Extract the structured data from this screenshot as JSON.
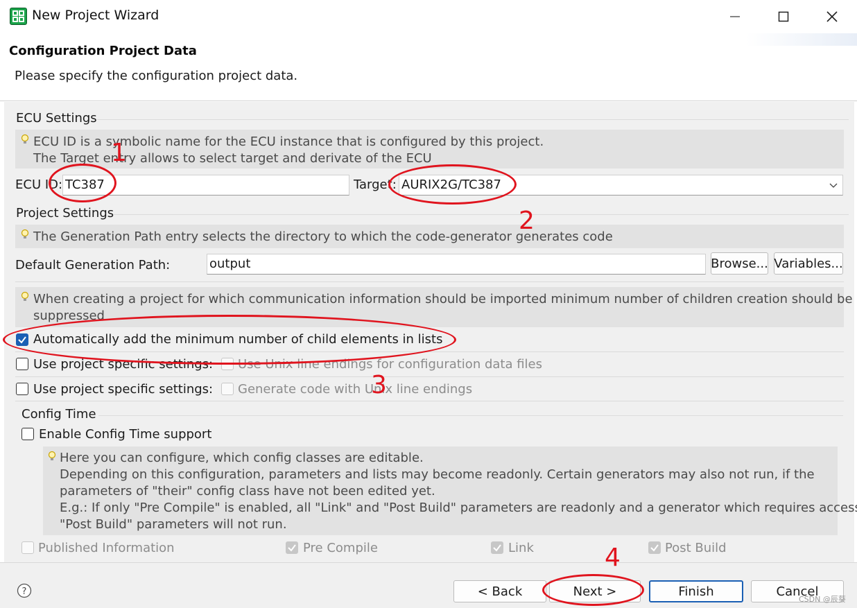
{
  "window": {
    "title": "New Project Wizard",
    "controls": [
      "minimize-icon",
      "maximize-icon",
      "close-icon"
    ]
  },
  "header": {
    "title": "Configuration Project Data",
    "description": "Please specify the configuration project data."
  },
  "ecu_settings": {
    "group_label": "ECU Settings",
    "hint_line1": "ECU ID is a symbolic name for the ECU instance that is configured by this project.",
    "hint_line2": "The Target entry allows to select target and derivate of the ECU",
    "ecu_id_label": "ECU ID:",
    "ecu_id_value": "TC387",
    "target_label": "Target:",
    "target_value": "AURIX2G/TC387"
  },
  "project_settings": {
    "group_label": "Project Settings",
    "hint": "The Generation Path entry selects the directory to which the code-generator generates code",
    "gen_path_label": "Default Generation Path:",
    "gen_path_value": "output",
    "browse_label": "Browse...",
    "variables_label": "Variables...",
    "hint2_line1": "When creating a project for which communication information should be imported minimum number of children creation should be",
    "hint2_line2": "suppressed",
    "auto_add_label": "Automatically add the minimum number of child elements in lists",
    "auto_add_checked": true,
    "specific1_label": "Use project specific settings:",
    "unix_cfg_label": "Use Unix line endings for configuration data files",
    "specific2_label": "Use project specific settings:",
    "unix_gen_label": "Generate code with Unix line endings"
  },
  "config_time": {
    "group_label": "Config Time",
    "enable_label": "Enable Config Time support",
    "hint_lines": [
      "Here you can configure, which config classes are editable.",
      "Depending on this configuration, parameters and lists may become readonly. Certain generators may also not run, if the",
      "parameters of \"their\" config class have not been edited yet.",
      "E.g.: If only \"Pre Compile\" is enabled, all \"Link\" and \"Post Build\" parameters are readonly and a generator which requires access to",
      "\"Post Build\" parameters will not run."
    ],
    "classes": {
      "published": "Published Information",
      "pre_compile": "Pre Compile",
      "link": "Link",
      "post_build": "Post Build"
    }
  },
  "footer": {
    "help_icon": "help-icon",
    "back_label": "< Back",
    "next_label": "Next >",
    "finish_label": "Finish",
    "cancel_label": "Cancel"
  },
  "annotations": {
    "n1": "1",
    "n2": "2",
    "n3": "3",
    "n4": "4",
    "color": "#e0141e"
  },
  "watermark": "CSDN @辰葵"
}
